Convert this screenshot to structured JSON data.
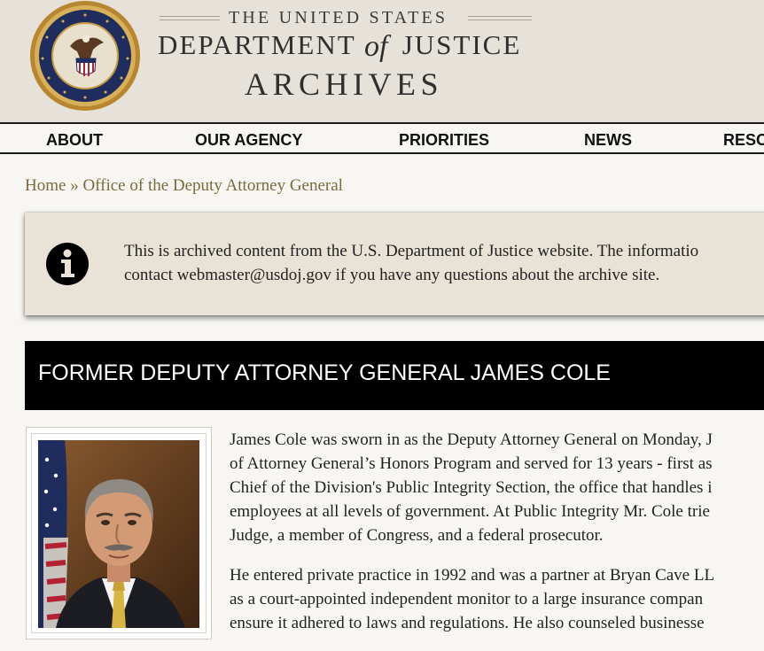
{
  "header": {
    "line1": "THE UNITED STATES",
    "line2_left": "DEPARTMENT",
    "line2_of": "of",
    "line2_right": "JUSTICE",
    "line3": "ARCHIVES",
    "seal_text": "DEPARTMENT OF JUSTICE"
  },
  "nav": {
    "items": [
      "ABOUT",
      "OUR AGENCY",
      "PRIORITIES",
      "NEWS",
      "RESO"
    ]
  },
  "breadcrumb": {
    "home": "Home",
    "separator": "»",
    "current": "Office of the Deputy Attorney General"
  },
  "alert": {
    "icon": "info-icon",
    "line1": "This is archived content from the U.S. Department of Justice website. The informatio",
    "line2": "contact webmaster@usdoj.gov if you have any questions about the archive site."
  },
  "page_title": "FORMER DEPUTY ATTORNEY GENERAL JAMES COLE",
  "portrait": {
    "alt": "James Cole"
  },
  "body": {
    "p1": [
      "James Cole was sworn in as the Deputy Attorney General on Monday, J",
      "of Attorney General’s Honors Program and served for 13 years - first as",
      "Chief of the Division's Public Integrity Section, the office that handles i",
      "employees at all levels of government. At Public Integrity Mr. Cole trie",
      "Judge, a member of Congress, and a federal prosecutor."
    ],
    "p2": [
      "He entered private practice in 1992 and was a partner at Bryan Cave LL",
      "as a court-appointed independent monitor to a large insurance compan",
      "ensure it adhered to laws and regulations. He also counseled businesse"
    ]
  },
  "colors": {
    "header_bg": "#e6e1d9",
    "page_bg": "#f7f6f2",
    "link": "#7a6a3c",
    "alert_bg": "#e9e2d6",
    "title_bar_bg": "#000000"
  }
}
